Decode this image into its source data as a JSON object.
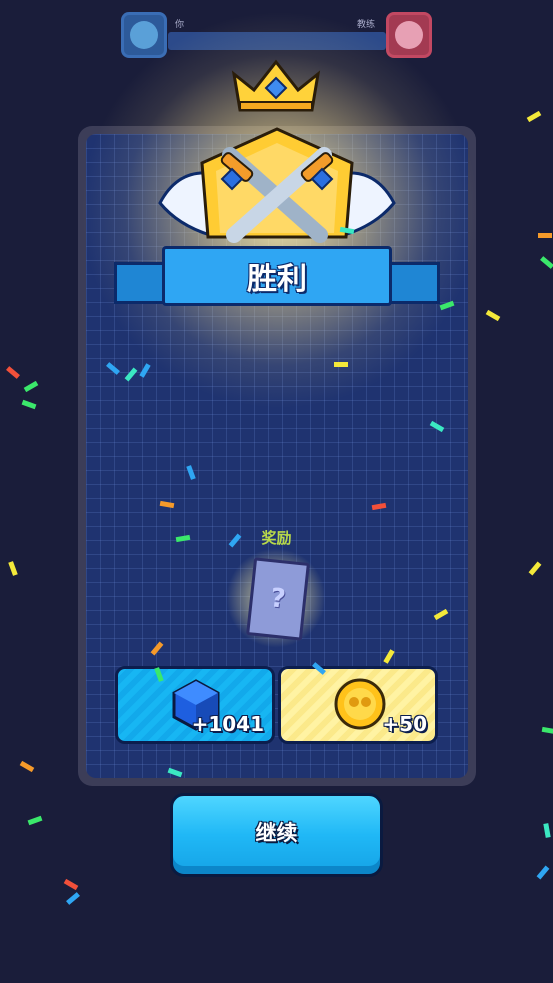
{
  "header": {
    "you_label": "你",
    "coach_label": "教练"
  },
  "result": {
    "title": "胜利"
  },
  "rewards": {
    "label": "奖励",
    "mystery_mark": "?",
    "gems_amount": "+1041",
    "coins_amount": "+50"
  },
  "actions": {
    "continue_label": "继续"
  },
  "colors": {
    "background": "#1a1d3a",
    "board": "#1f3370",
    "ribbon": "#2fa6f3",
    "continue": "#20b8f6",
    "gold": "#ffd23a",
    "reward_label": "#b8d94a"
  },
  "icons": [
    "avatar-you",
    "avatar-coach",
    "crown-icon",
    "crossed-swords-emblem",
    "mystery-ticket-icon",
    "gem-cube-icon",
    "gold-coin-icon"
  ]
}
